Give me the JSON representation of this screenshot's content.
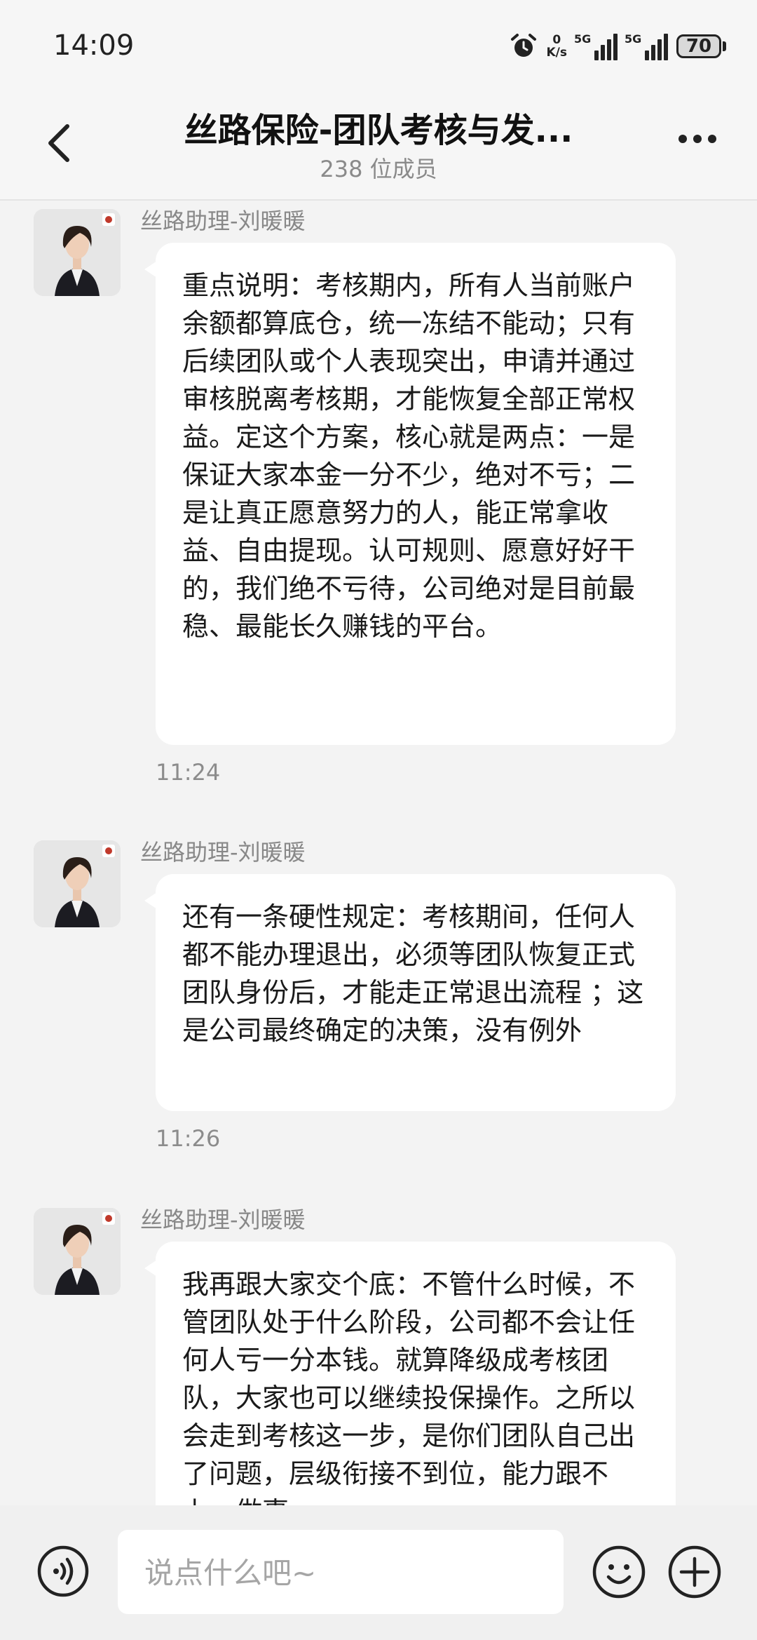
{
  "status_bar": {
    "time": "14:09",
    "net_speed_value": "0",
    "net_speed_unit": "K/s",
    "signal1_label": "5G",
    "signal2_label": "5G",
    "battery": "70"
  },
  "header": {
    "title": "丝路保险-团队考核与发...",
    "subtitle": "238 位成员"
  },
  "messages": [
    {
      "sender": "丝路助理-刘暖暖",
      "text": "重点说明：考核期内，所有人当前账户余额都算底仓，统一冻结不能动；只有后续团队或个人表现突出，申请并通过审核脱离考核期，才能恢复全部正常权益。定这个方案，核心就是两点：一是保证大家本金一分不少，绝对不亏；二是让真正愿意努力的人，能正常拿收益、自由提现。认可规则、愿意好好干的，我们绝不亏待，公司绝对是目前最稳、最能长久赚钱的平台。",
      "time": "11:24"
    },
    {
      "sender": "丝路助理-刘暖暖",
      "text": "还有一条硬性规定：考核期间，任何人都不能办理退出，必须等团队恢复正式团队身份后，才能走正常退出流程 ；这是公司最终确定的决策，没有例外",
      "time": "11:26"
    },
    {
      "sender": "丝路助理-刘暖暖",
      "text": "我再跟大家交个底：不管什么时候，不管团队处于什么阶段，公司都不会让任何人亏一分本钱。就算降级成考核团队，大家也可以继续投保操作。之所以会走到考核这一步，是你们团队自己出了问题，层级衔接不到位，能力跟不上，做事",
      "time": ""
    }
  ],
  "input": {
    "placeholder": "说点什么吧~"
  },
  "colors": {
    "background": "#f3f3f3",
    "bubble": "#ffffff",
    "muted_text": "#8c8c8c"
  },
  "icons": [
    "back-arrow-icon",
    "more-dots-icon",
    "voice-icon",
    "emoji-icon",
    "plus-icon",
    "alarm-icon"
  ]
}
